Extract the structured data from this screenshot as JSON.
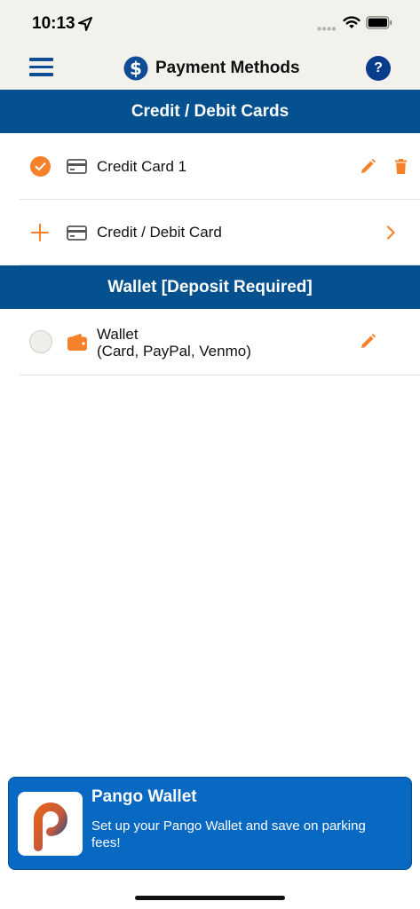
{
  "status_bar": {
    "time": "10:13"
  },
  "header": {
    "title": "Payment Methods",
    "help_label": "?"
  },
  "sections": [
    {
      "title": "Credit / Debit Cards"
    },
    {
      "title": "Wallet [Deposit Required]"
    }
  ],
  "cards": {
    "saved_card": {
      "label": "Credit Card 1",
      "selected": true
    },
    "add_card": {
      "label": "Credit / Debit Card"
    }
  },
  "wallet": {
    "label_line1": "Wallet",
    "label_line2": "(Card, PayPal, Venmo)",
    "selected": false
  },
  "banner": {
    "title": "Pango Wallet",
    "text": "Set up your Pango Wallet and save on parking fees!"
  },
  "colors": {
    "brand_blue": "#05508e",
    "accent_orange": "#f5822a",
    "banner_blue": "#0769c2"
  },
  "icons": [
    "menu-icon",
    "dollar-logo-icon",
    "help-icon",
    "check-icon",
    "credit-card-icon",
    "plus-icon",
    "pencil-icon",
    "trash-icon",
    "chevron-right-icon",
    "wallet-icon",
    "pango-logo-icon"
  ]
}
